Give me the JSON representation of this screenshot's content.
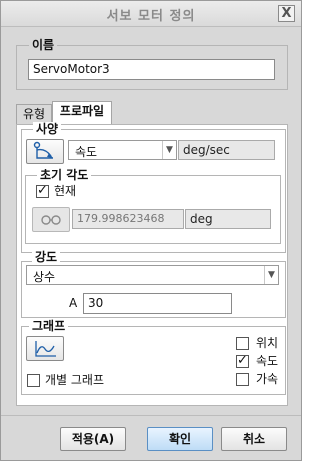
{
  "window": {
    "title": "서보 모터 정의",
    "close_label": "X"
  },
  "name_section": {
    "legend": "이름",
    "value": "ServoMotor3"
  },
  "tabs": [
    {
      "label": "유형",
      "active": false
    },
    {
      "label": "프로파일",
      "active": true
    }
  ],
  "spec": {
    "legend": "사양",
    "quantity_value": "속도",
    "unit_value": "deg/sec",
    "initial_angle": {
      "legend": "초기 각도",
      "current_label": "현재",
      "current_checked": true,
      "angle_value": "179.998623468",
      "angle_unit": "deg"
    }
  },
  "magnitude": {
    "legend": "강도",
    "type_value": "상수",
    "param_label": "A",
    "param_value": "30"
  },
  "graph": {
    "legend": "그래프",
    "separate_label": "개별 그래프",
    "separate_checked": false,
    "options": [
      {
        "label": "위치",
        "checked": false
      },
      {
        "label": "속도",
        "checked": true
      },
      {
        "label": "가속",
        "checked": false
      }
    ]
  },
  "buttons": {
    "apply": "적용(A)",
    "ok": "확인",
    "cancel": "취소"
  }
}
